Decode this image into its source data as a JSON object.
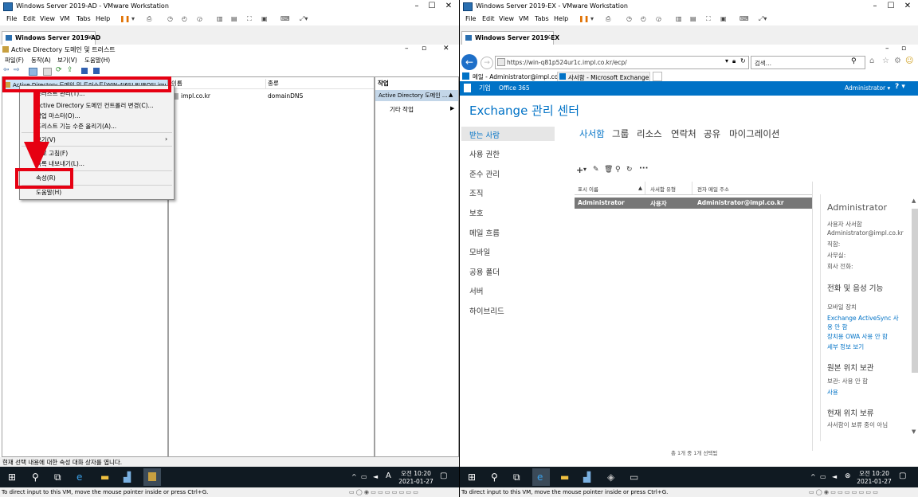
{
  "left_window": {
    "title": "Windows Server 2019-AD - VMware Workstation",
    "menu": [
      "File",
      "Edit",
      "View",
      "VM",
      "Tabs",
      "Help"
    ],
    "vm_tab": "Windows Server 2019-AD",
    "console": {
      "title": "Active Directory 도메인 및 트러스트",
      "menu": [
        "파일(F)",
        "동작(A)",
        "보기(V)",
        "도움말(H)"
      ],
      "tree_root": "Active Directory 도메인 및 트러스트[WIN-4J6SL8URQSI.impl.co.kr]",
      "list_headers": [
        "이름",
        "종류"
      ],
      "list_rows": [
        {
          "name": "impl.co.kr",
          "type": "domainDNS"
        }
      ],
      "actions_header": "작업",
      "actions_selected": "Active Directory 도메인 ...",
      "actions_more": "기타 작업",
      "context_menu": [
        "트러스트 관리(T)...",
        "Active Directory 도메인 컨트롤러 변경(C)...",
        "작업 마스터(O)...",
        "포리스트 기능 수준 올리기(A)...",
        "보기(V)",
        "새로 고침(F)",
        "목록 내보내기(L)...",
        "속성(R)",
        "도움말(H)"
      ],
      "status": "현재 선택 내용에 대한 속성 대화 상자를 엽니다."
    },
    "clock": {
      "time": "오전 10:20",
      "date": "2021-01-27"
    },
    "ime": "A",
    "hint": "To direct input to this VM, move the mouse pointer inside or press Ctrl+G."
  },
  "right_window": {
    "title": "Windows Server 2019-EX - VMware Workstation",
    "menu": [
      "File",
      "Edit",
      "View",
      "VM",
      "Tabs",
      "Help"
    ],
    "vm_tab": "Windows Server 2019-EX",
    "browser": {
      "url": "https://win-q81p524ur1c.impl.co.kr/ecp/",
      "search_placeholder": "검색...",
      "tabs": [
        "메일 - Administrator@impl.co...",
        "사서함 - Microsoft Exchange"
      ]
    },
    "ecp": {
      "top_left": "기업",
      "office": "Office 365",
      "user": "Administrator ▾",
      "help": "? ▾",
      "title": "Exchange 관리 센터",
      "nav": [
        "받는 사람",
        "사용 권한",
        "준수 관리",
        "조직",
        "보호",
        "메일 흐름",
        "모바일",
        "공용 폴더",
        "서버",
        "하이브리드"
      ],
      "subnav": [
        "사서함",
        "그룹",
        "리소스",
        "연락처",
        "공유",
        "마이그레이션"
      ],
      "columns": [
        "표시 이름",
        "사서함 유형",
        "전자 메일 주소"
      ],
      "rows": [
        {
          "name": "Administrator",
          "type": "사용자",
          "email": "Administrator@impl.co.kr"
        }
      ],
      "footer": "총 1개 중 1개 선택됨",
      "detail": {
        "name": "Administrator",
        "type": "사용자 사서함",
        "email": "Administrator@impl.co.kr",
        "title_label": "직함:",
        "office_label": "사무실:",
        "phone_label": "회사 전화:",
        "section_phone": "전화 및 음성 기능",
        "mobile_devices": "모바일 장치",
        "activesync": "Exchange ActiveSync 사용 안 함",
        "owa": "장치용 OWA 사용 안 함",
        "details": "세부 정보 보기",
        "section_archive": "원본 위치 보관",
        "archive_status": "보관: 사용 안 함",
        "archive_enable": "사용",
        "section_hold": "현재 위치 보류",
        "hold_status": "사서함이 보류 중이 아님"
      }
    },
    "clock": {
      "time": "오전 10:20",
      "date": "2021-01-27"
    },
    "hint": "To direct input to this VM, move the mouse pointer inside or press Ctrl+G."
  }
}
